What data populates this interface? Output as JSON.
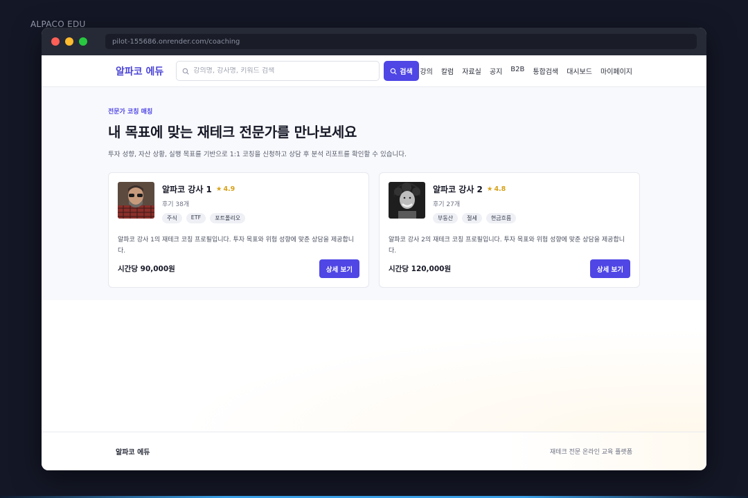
{
  "outer": {
    "label": "ALPACO EDU"
  },
  "browser": {
    "url": "pilot-155686.onrender.com/coaching"
  },
  "nav": {
    "brand": "알파코 에듀",
    "search_placeholder": "강의명, 강사명, 키워드 검색",
    "search_button": "검색",
    "links": [
      "강의",
      "칼럼",
      "자료실",
      "공지",
      "B2B",
      "통합검색",
      "대시보드",
      "마이페이지"
    ]
  },
  "hero": {
    "eyebrow": "전문가 코칭 매칭",
    "title": "내 목표에 맞는 재테크 전문가를 만나보세요",
    "subtitle": "투자 성향, 자산 상황, 실행 목표를 기반으로 1:1 코칭을 신청하고 상담 후 분석 리포트를 확인할 수 있습니다."
  },
  "coaches": [
    {
      "name": "알파코 강사 1",
      "rating": "4.9",
      "reviews": "후기 38개",
      "tags": [
        "주식",
        "ETF",
        "포트폴리오"
      ],
      "description": "알파코 강사 1의 재테크 코칭 프로필입니다. 투자 목표와 위험 성향에 맞춘 상담을 제공합니다.",
      "price": "시간당 90,000원",
      "button": "상세 보기"
    },
    {
      "name": "알파코 강사 2",
      "rating": "4.8",
      "reviews": "후기 27개",
      "tags": [
        "부동산",
        "절세",
        "현금흐름"
      ],
      "description": "알파코 강사 2의 재테크 코칭 프로필입니다. 투자 목표와 위험 성향에 맞춘 상담을 제공합니다.",
      "price": "시간당 120,000원",
      "button": "상세 보기"
    }
  ],
  "footer": {
    "brand": "알파코 에듀",
    "tagline": "재테크 전문 온라인 교육 플랫폼"
  },
  "colors": {
    "accent": "#4f46e5",
    "brand_text": "#4b44d6",
    "star": "#d7a21b"
  }
}
